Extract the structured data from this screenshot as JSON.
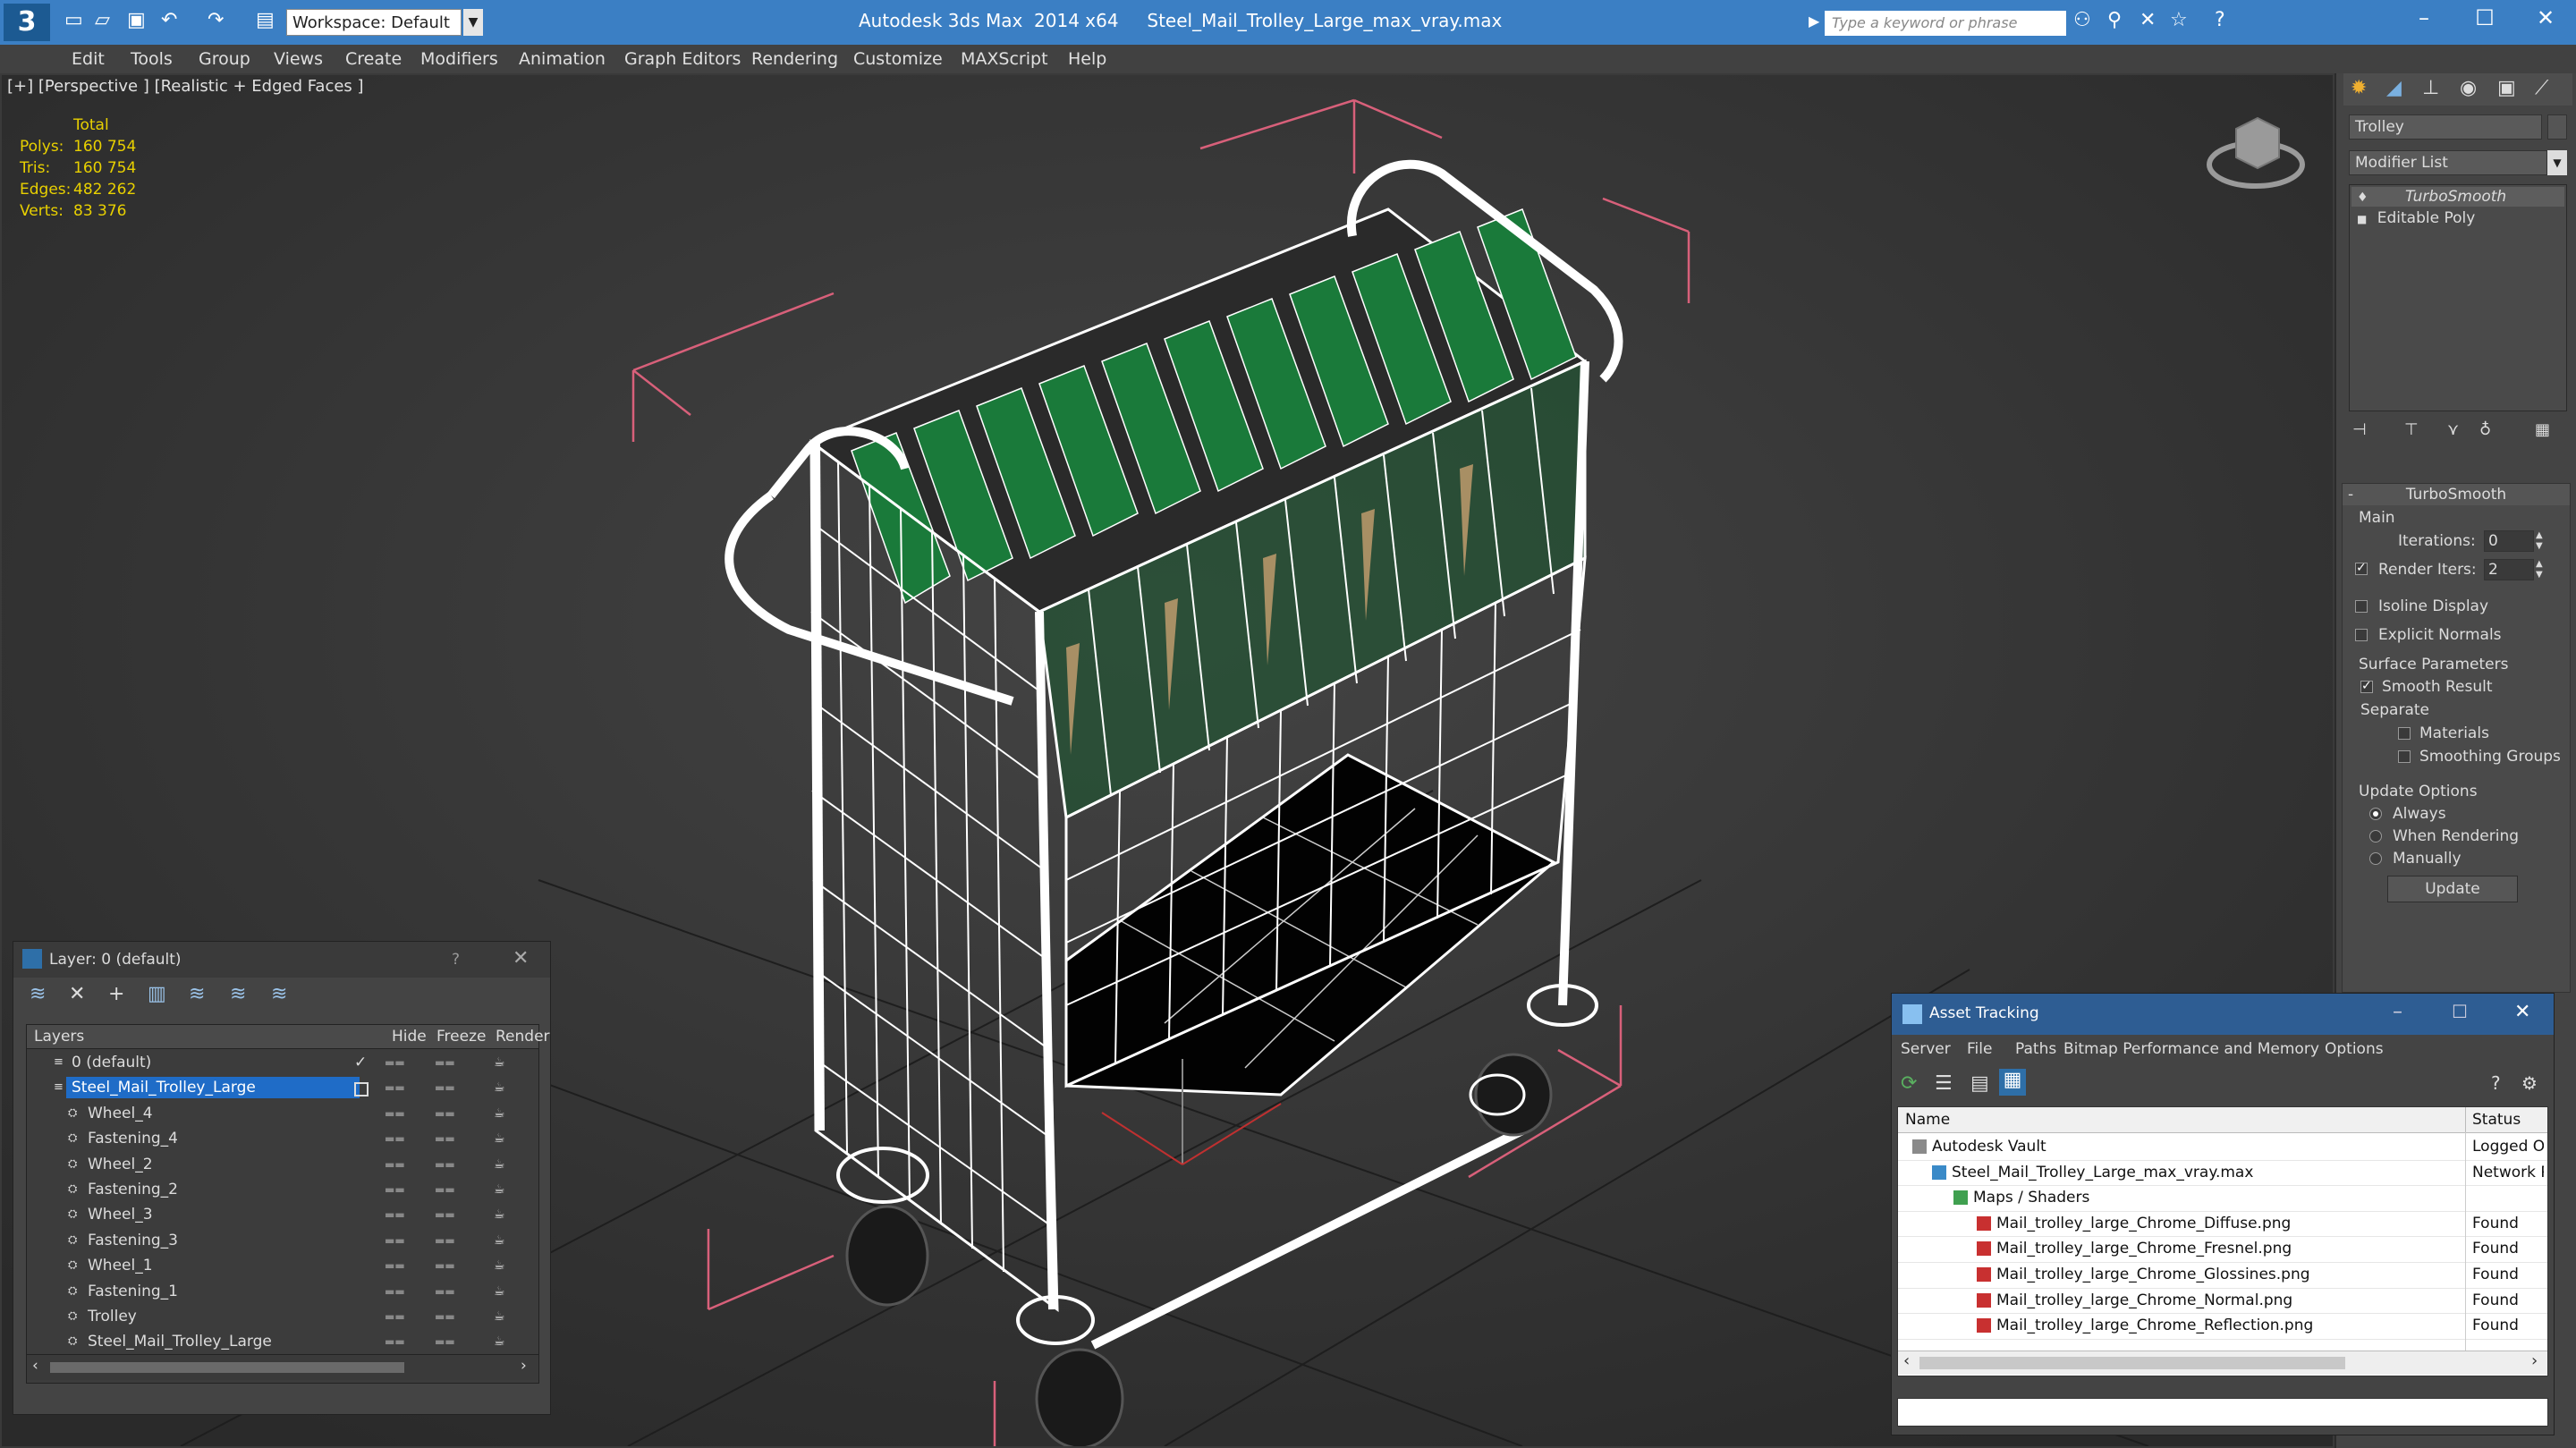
{
  "titlebar": {
    "app_title": "Autodesk 3ds Max  2014 x64     Steel_Mail_Trolley_Large_max_vray.max",
    "workspace": "Workspace: Default",
    "search_placeholder": "Type a keyword or phrase"
  },
  "menu": [
    "Edit",
    "Tools",
    "Group",
    "Views",
    "Create",
    "Modifiers",
    "Animation",
    "Graph Editors",
    "Rendering",
    "Customize",
    "MAXScript",
    "Help"
  ],
  "viewport": {
    "label": "[+] [Perspective ] [Realistic + Edged Faces ]",
    "stats": {
      "header": "Total",
      "rows": [
        {
          "label": "Polys:",
          "value": "160 754"
        },
        {
          "label": "Tris:",
          "value": "160 754"
        },
        {
          "label": "Edges:",
          "value": "482 262"
        },
        {
          "label": "Verts:",
          "value": "83 376"
        }
      ]
    }
  },
  "command_panel": {
    "object_name": "Trolley",
    "modifier_list": "Modifier List",
    "stack": [
      "TurboSmooth",
      "Editable Poly"
    ],
    "rollout_title": "TurboSmooth",
    "main_label": "Main",
    "iterations_label": "Iterations:",
    "iterations_value": "0",
    "render_iters_label": "Render Iters:",
    "render_iters_value": "2",
    "isoline": "Isoline Display",
    "explicit_normals": "Explicit Normals",
    "surface_params": "Surface Parameters",
    "smooth_result": "Smooth Result",
    "separate": "Separate",
    "materials": "Materials",
    "smoothing_groups": "Smoothing Groups",
    "update_options": "Update Options",
    "always": "Always",
    "when_rendering": "When Rendering",
    "manually": "Manually",
    "update_button": "Update"
  },
  "layer_window": {
    "title": "Layer: 0 (default)",
    "help": "?",
    "columns": [
      "Layers",
      "Hide",
      "Freeze",
      "Render"
    ],
    "rows": [
      {
        "name": "0 (default)",
        "indent": 1,
        "selected": false
      },
      {
        "name": "Steel_Mail_Trolley_Large",
        "indent": 1,
        "selected": true
      },
      {
        "name": "Wheel_4",
        "indent": 2,
        "selected": false
      },
      {
        "name": "Fastening_4",
        "indent": 2,
        "selected": false
      },
      {
        "name": "Wheel_2",
        "indent": 2,
        "selected": false
      },
      {
        "name": "Fastening_2",
        "indent": 2,
        "selected": false
      },
      {
        "name": "Wheel_3",
        "indent": 2,
        "selected": false
      },
      {
        "name": "Fastening_3",
        "indent": 2,
        "selected": false
      },
      {
        "name": "Wheel_1",
        "indent": 2,
        "selected": false
      },
      {
        "name": "Fastening_1",
        "indent": 2,
        "selected": false
      },
      {
        "name": "Trolley",
        "indent": 2,
        "selected": false
      },
      {
        "name": "Steel_Mail_Trolley_Large",
        "indent": 2,
        "selected": false
      }
    ]
  },
  "asset_tracking": {
    "title": "Asset Tracking",
    "menu": [
      "Server",
      "File",
      "Paths",
      "Bitmap Performance and Memory",
      "Options"
    ],
    "columns": [
      "Name",
      "Status"
    ],
    "rows": [
      {
        "name": "Autodesk Vault",
        "status": "Logged Ou",
        "indent": 1
      },
      {
        "name": "Steel_Mail_Trolley_Large_max_vray.max",
        "status": "Network Pa",
        "indent": 2
      },
      {
        "name": "Maps / Shaders",
        "status": "",
        "indent": 3
      },
      {
        "name": "Mail_trolley_large_Chrome_Diffuse.png",
        "status": "Found",
        "indent": 4
      },
      {
        "name": "Mail_trolley_large_Chrome_Fresnel.png",
        "status": "Found",
        "indent": 4
      },
      {
        "name": "Mail_trolley_large_Chrome_Glossines.png",
        "status": "Found",
        "indent": 4
      },
      {
        "name": "Mail_trolley_large_Chrome_Normal.png",
        "status": "Found",
        "indent": 4
      },
      {
        "name": "Mail_trolley_large_Chrome_Reflection.png",
        "status": "Found",
        "indent": 4
      }
    ]
  },
  "colors": {
    "titlebar": "#3b7fc4",
    "selection": "#1f6cc7",
    "stats": "#e8d000",
    "wire": "#ffffff",
    "box": "#d8607a",
    "folder_green": "#1a7a3a"
  }
}
